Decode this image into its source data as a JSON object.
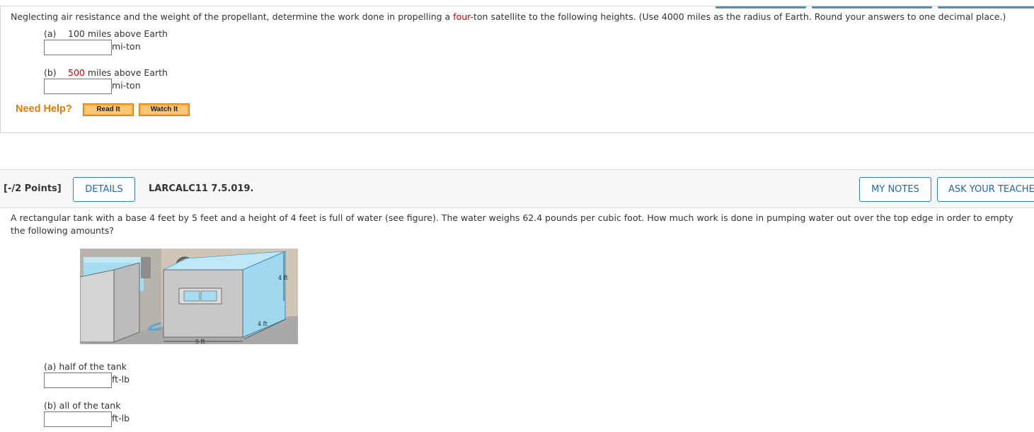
{
  "question1": {
    "prompt_before": "Neglecting air resistance and the weight of the propellant, determine the work done in propelling a ",
    "prompt_highlight": "four",
    "prompt_after": "-ton satellite to the following heights. (Use 4000 miles as the radius of Earth. Round your answers to one decimal place.)",
    "parts": [
      {
        "letter": "(a)",
        "value_text": "100",
        "rest_text": " miles above Earth",
        "answer": "",
        "unit": "mi-ton"
      },
      {
        "letter": "(b)",
        "value_text": "500",
        "rest_text": " miles above Earth",
        "answer": "",
        "unit": "mi-ton"
      }
    ],
    "help": {
      "label": "Need Help?",
      "read_it": "Read It",
      "watch_it": "Watch It"
    }
  },
  "question2": {
    "points": "[-/2 Points]",
    "details_button": "DETAILS",
    "id": "LARCALC11 7.5.019.",
    "my_notes_button": "MY NOTES",
    "ask_button": "ASK YOUR TEACHER",
    "prompt": "A rectangular tank with a base 4 feet by 5 feet and a height of 4 feet is full of water (see figure). The water weighs 62.4 pounds per cubic foot. How much work is done in pumping water out over the top edge in order to empty the following amounts?",
    "figure": {
      "height_label": "4 ft",
      "depth_label": "4 ft",
      "width_label": "5 ft"
    },
    "parts": [
      {
        "label": "(a) half of the tank",
        "answer": "",
        "unit": "ft-lb"
      },
      {
        "label": "(b) all of the tank",
        "answer": "",
        "unit": "ft-lb"
      }
    ]
  },
  "colors": {
    "accent_blue": "#2f7fbd",
    "help_orange": "#e07a00",
    "highlight_red": "#cc0000"
  }
}
